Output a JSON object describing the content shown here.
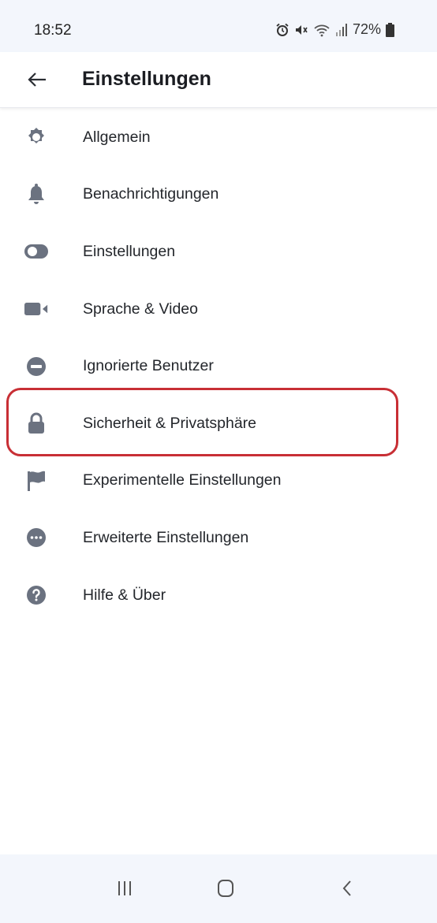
{
  "status_bar": {
    "time": "18:52",
    "battery": "72%",
    "icons": [
      "alarm-icon",
      "mute-icon",
      "wifi-icon",
      "signal-icon",
      "battery-icon"
    ]
  },
  "app_bar": {
    "title": "Einstellungen",
    "back_icon": "back-arrow-icon"
  },
  "settings": {
    "items": [
      {
        "label": "Allgemein",
        "icon": "gear-icon"
      },
      {
        "label": "Benachrichtigungen",
        "icon": "bell-icon"
      },
      {
        "label": "Einstellungen",
        "icon": "toggle-icon"
      },
      {
        "label": "Sprache & Video",
        "icon": "video-camera-icon"
      },
      {
        "label": "Ignorierte Benutzer",
        "icon": "block-icon"
      },
      {
        "label": "Sicherheit & Privatsphäre",
        "icon": "lock-icon",
        "highlighted": true
      },
      {
        "label": "Experimentelle Einstellungen",
        "icon": "flag-icon"
      },
      {
        "label": "Erweiterte Einstellungen",
        "icon": "more-dots-icon"
      },
      {
        "label": "Hilfe & Über",
        "icon": "help-icon"
      }
    ]
  },
  "colors": {
    "icon": "#6b7280",
    "highlight_border": "#c82f35",
    "bar_background": "#f3f6fc"
  },
  "nav_bar": {
    "buttons": [
      "recent-apps-icon",
      "home-icon",
      "back-icon"
    ]
  }
}
